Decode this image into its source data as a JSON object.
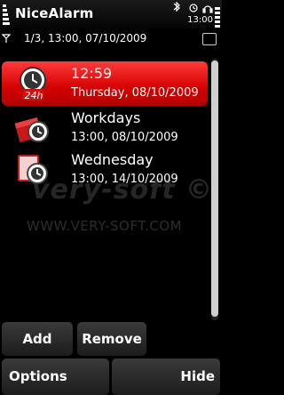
{
  "app": {
    "title": "NiceAlarm"
  },
  "status": {
    "time": "13:00"
  },
  "header": {
    "next_alarm": "1/3, 13:00, 07/10/2009"
  },
  "alarms": [
    {
      "title": "12:59",
      "subtitle": "Thursday, 08/10/2009",
      "icon": "24h-alarm-icon",
      "selected": true
    },
    {
      "title": "Workdays",
      "subtitle": "13:00, 08/10/2009",
      "icon": "workdays-alarm-icon",
      "selected": false
    },
    {
      "title": "Wednesday",
      "subtitle": "13:00, 14/10/2009",
      "icon": "calendar-alarm-icon",
      "selected": false
    }
  ],
  "watermark": {
    "logo": "very-soft ©",
    "url": "WWW.VERY-SOFT.COM"
  },
  "buttons": {
    "add": "Add",
    "remove": "Remove"
  },
  "softkeys": {
    "left": "Options",
    "right": "Hide"
  },
  "colors": {
    "selected_accent": "#e01010",
    "background": "#000000"
  }
}
